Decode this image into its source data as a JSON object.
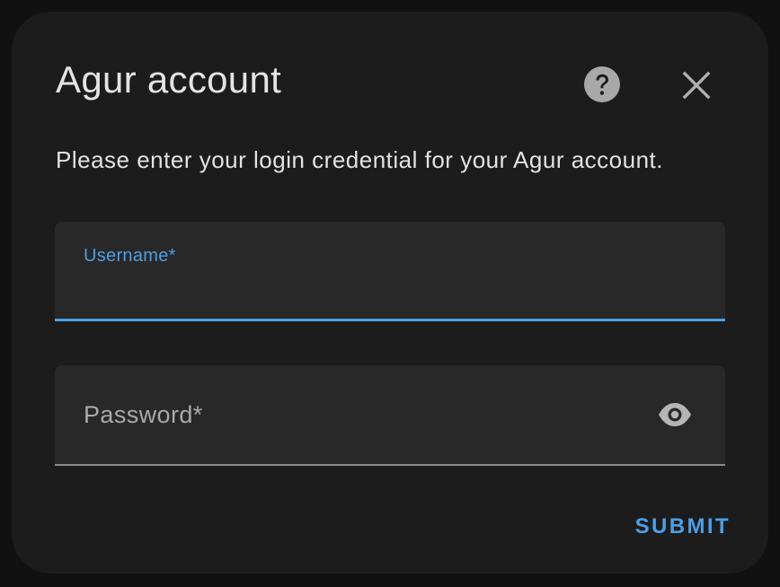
{
  "dialog": {
    "title": "Agur account",
    "description": "Please enter your login credential for your Agur account.",
    "help_icon": "help-circle-icon",
    "close_icon": "close-icon"
  },
  "form": {
    "username": {
      "label": "Username*",
      "value": ""
    },
    "password": {
      "label": "Password*",
      "value": "",
      "toggle_icon": "eye-icon"
    },
    "submit_label": "SUBMIT"
  },
  "colors": {
    "accent": "#4a9fe6",
    "dialog_bg": "#1c1c1c",
    "field_bg": "#282828",
    "page_bg": "#111111"
  }
}
